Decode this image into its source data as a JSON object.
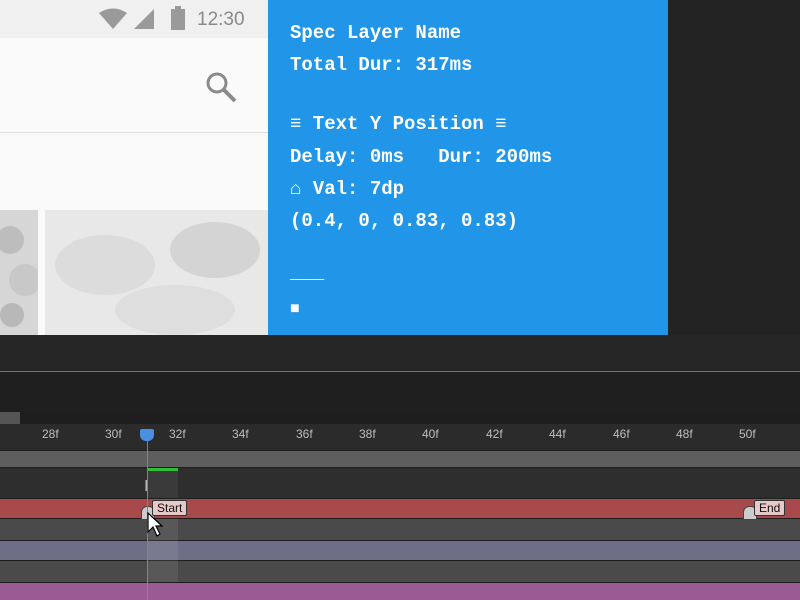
{
  "phone": {
    "time": "12:30",
    "icons": [
      "wifi-icon",
      "signal-icon",
      "battery-icon",
      "search-icon"
    ]
  },
  "spec": {
    "layer_name": "Spec Layer Name",
    "total_dur": "Total Dur: 317ms",
    "section_header": "≡ Text Y Position ≡",
    "delay_dur": "Delay: 0ms   Dur: 200ms",
    "value": "⌂ Val: 7dp",
    "curve": "(0.4, 0, 0.83, 0.83)",
    "separator": "___",
    "cursor": "■"
  },
  "timeline": {
    "ticks": [
      "28f",
      "30f",
      "32f",
      "34f",
      "36f",
      "38f",
      "40f",
      "42f",
      "44f",
      "46f",
      "48f",
      "50f"
    ],
    "markers": {
      "start": "Start",
      "end": "End"
    }
  },
  "colors": {
    "spec_bg": "#2196e9",
    "red_track": "#a84a4c",
    "gray_blue_track": "#6e6e86",
    "purple_track": "#9a5a93",
    "playhead": "#4a90e2",
    "green_bar": "#2fbf3a"
  }
}
